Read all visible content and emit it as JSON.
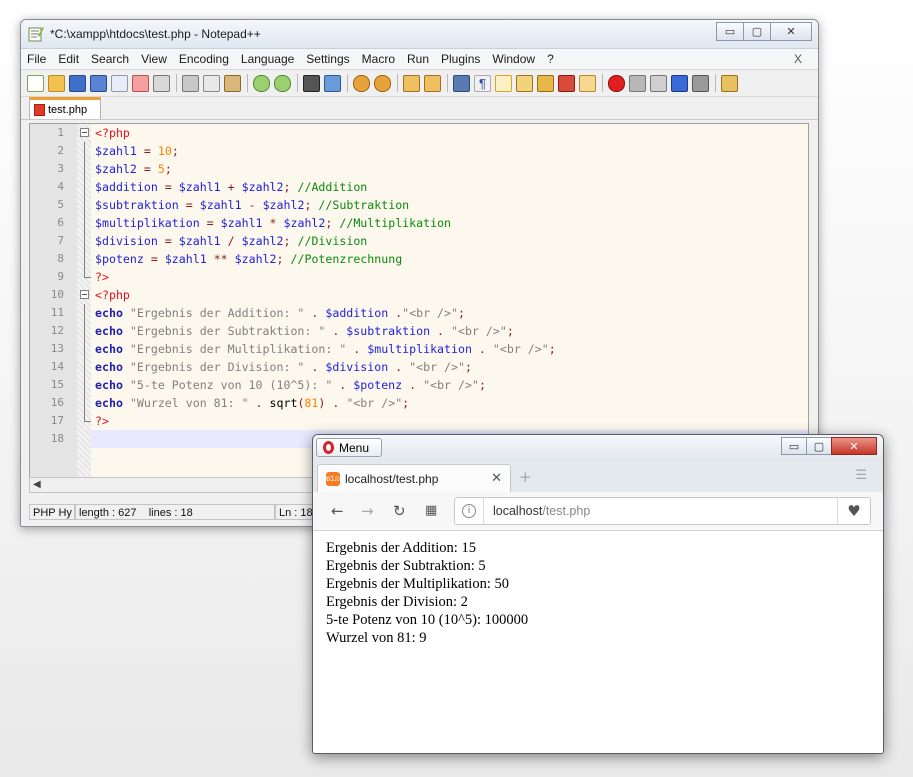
{
  "notepad": {
    "title": "*C:\\xampp\\htdocs\\test.php - Notepad++",
    "controls": {
      "minimize": "▭",
      "maximize": "▢",
      "close": "✕"
    },
    "menu": [
      "File",
      "Edit",
      "Search",
      "View",
      "Encoding",
      "Language",
      "Settings",
      "Macro",
      "Run",
      "Plugins",
      "Window",
      "?"
    ],
    "menu_close": "X",
    "tab": "test.php",
    "lines": [
      {
        "n": "1",
        "parts": [
          [
            "tag",
            "<?php"
          ]
        ]
      },
      {
        "n": "2",
        "parts": [
          [
            "var",
            "$zahl1"
          ],
          [
            "op",
            " = "
          ],
          [
            "num",
            "10"
          ],
          [
            "op",
            ";"
          ]
        ]
      },
      {
        "n": "3",
        "parts": [
          [
            "var",
            "$zahl2"
          ],
          [
            "op",
            " = "
          ],
          [
            "num",
            "5"
          ],
          [
            "op",
            ";"
          ]
        ]
      },
      {
        "n": "4",
        "parts": [
          [
            "var",
            "$addition"
          ],
          [
            "op",
            " = "
          ],
          [
            "var",
            "$zahl1"
          ],
          [
            "op",
            " + "
          ],
          [
            "var",
            "$zahl2"
          ],
          [
            "op",
            "; "
          ],
          [
            "cm",
            "//Addition"
          ]
        ]
      },
      {
        "n": "5",
        "parts": [
          [
            "var",
            "$subtraktion"
          ],
          [
            "op",
            " = "
          ],
          [
            "var",
            "$zahl1"
          ],
          [
            "op",
            " - "
          ],
          [
            "var",
            "$zahl2"
          ],
          [
            "op",
            "; "
          ],
          [
            "cm",
            "//Subtraktion"
          ]
        ]
      },
      {
        "n": "6",
        "parts": [
          [
            "var",
            "$multiplikation"
          ],
          [
            "op",
            " = "
          ],
          [
            "var",
            "$zahl1"
          ],
          [
            "op",
            " * "
          ],
          [
            "var",
            "$zahl2"
          ],
          [
            "op",
            "; "
          ],
          [
            "cm",
            "//Multiplikation"
          ]
        ]
      },
      {
        "n": "7",
        "parts": [
          [
            "var",
            "$division"
          ],
          [
            "op",
            " = "
          ],
          [
            "var",
            "$zahl1"
          ],
          [
            "op",
            " / "
          ],
          [
            "var",
            "$zahl2"
          ],
          [
            "op",
            "; "
          ],
          [
            "cm",
            "//Division"
          ]
        ]
      },
      {
        "n": "8",
        "parts": [
          [
            "var",
            "$potenz"
          ],
          [
            "op",
            " = "
          ],
          [
            "var",
            "$zahl1"
          ],
          [
            "op",
            " ** "
          ],
          [
            "var",
            "$zahl2"
          ],
          [
            "op",
            "; "
          ],
          [
            "cm",
            "//Potenzrechnung"
          ]
        ]
      },
      {
        "n": "9",
        "parts": [
          [
            "tag",
            "?>"
          ]
        ]
      },
      {
        "n": "10",
        "parts": [
          [
            "tag",
            "<?php"
          ]
        ]
      },
      {
        "n": "11",
        "parts": [
          [
            "kw",
            "echo"
          ],
          [
            "str",
            " \"Ergebnis der Addition: \""
          ],
          [
            "op",
            " . "
          ],
          [
            "var",
            "$addition"
          ],
          [
            "op",
            " ."
          ],
          [
            "str",
            "\"<br />\""
          ],
          [
            "op",
            ";"
          ]
        ]
      },
      {
        "n": "12",
        "parts": [
          [
            "kw",
            "echo"
          ],
          [
            "str",
            " \"Ergebnis der Subtraktion: \""
          ],
          [
            "op",
            " . "
          ],
          [
            "var",
            "$subtraktion"
          ],
          [
            "op",
            " . "
          ],
          [
            "str",
            "\"<br />\""
          ],
          [
            "op",
            ";"
          ]
        ]
      },
      {
        "n": "13",
        "parts": [
          [
            "kw",
            "echo"
          ],
          [
            "str",
            " \"Ergebnis der Multiplikation: \""
          ],
          [
            "op",
            " . "
          ],
          [
            "var",
            "$multiplikation"
          ],
          [
            "op",
            " . "
          ],
          [
            "str",
            "\"<br />\""
          ],
          [
            "op",
            ";"
          ]
        ]
      },
      {
        "n": "14",
        "parts": [
          [
            "kw",
            "echo"
          ],
          [
            "str",
            " \"Ergebnis der Division: \""
          ],
          [
            "op",
            " . "
          ],
          [
            "var",
            "$division"
          ],
          [
            "op",
            " . "
          ],
          [
            "str",
            "\"<br />\""
          ],
          [
            "op",
            ";"
          ]
        ]
      },
      {
        "n": "15",
        "parts": [
          [
            "kw",
            "echo"
          ],
          [
            "str",
            " \"5-te Potenz von 10 (10^5): \""
          ],
          [
            "op",
            " . "
          ],
          [
            "var",
            "$potenz"
          ],
          [
            "op",
            " . "
          ],
          [
            "str",
            "\"<br />\""
          ],
          [
            "op",
            ";"
          ]
        ]
      },
      {
        "n": "16",
        "parts": [
          [
            "kw",
            "echo"
          ],
          [
            "str",
            " \"Wurzel von 81: \""
          ],
          [
            "op",
            " . "
          ],
          [
            "plain",
            "sqrt"
          ],
          [
            "op",
            "("
          ],
          [
            "num",
            "81"
          ],
          [
            "op",
            ")"
          ],
          [
            "op",
            " . "
          ],
          [
            "str",
            "\"<br />\""
          ],
          [
            "op",
            ";"
          ]
        ]
      },
      {
        "n": "17",
        "parts": [
          [
            "tag",
            "?>"
          ]
        ]
      },
      {
        "n": "18",
        "parts": []
      }
    ],
    "status": {
      "lang": "PHP Hy",
      "length": "length : 627",
      "lines": "lines : 18",
      "ln": "Ln : 18"
    }
  },
  "browser": {
    "menu_label": "Menu",
    "controls": {
      "minimize": "▭",
      "maximize": "▢",
      "close": "✕"
    },
    "tab_title": "localhost/test.php",
    "tab_close": "✕",
    "new_tab": "+",
    "url_host": "localhost",
    "url_path": "/test.php",
    "output": [
      "Ergebnis der Addition: 15",
      "Ergebnis der Subtraktion: 5",
      "Ergebnis der Multiplikation: 50",
      "Ergebnis der Division: 2",
      "5-te Potenz von 10 (10^5): 100000",
      "Wurzel von 81: 9"
    ]
  }
}
